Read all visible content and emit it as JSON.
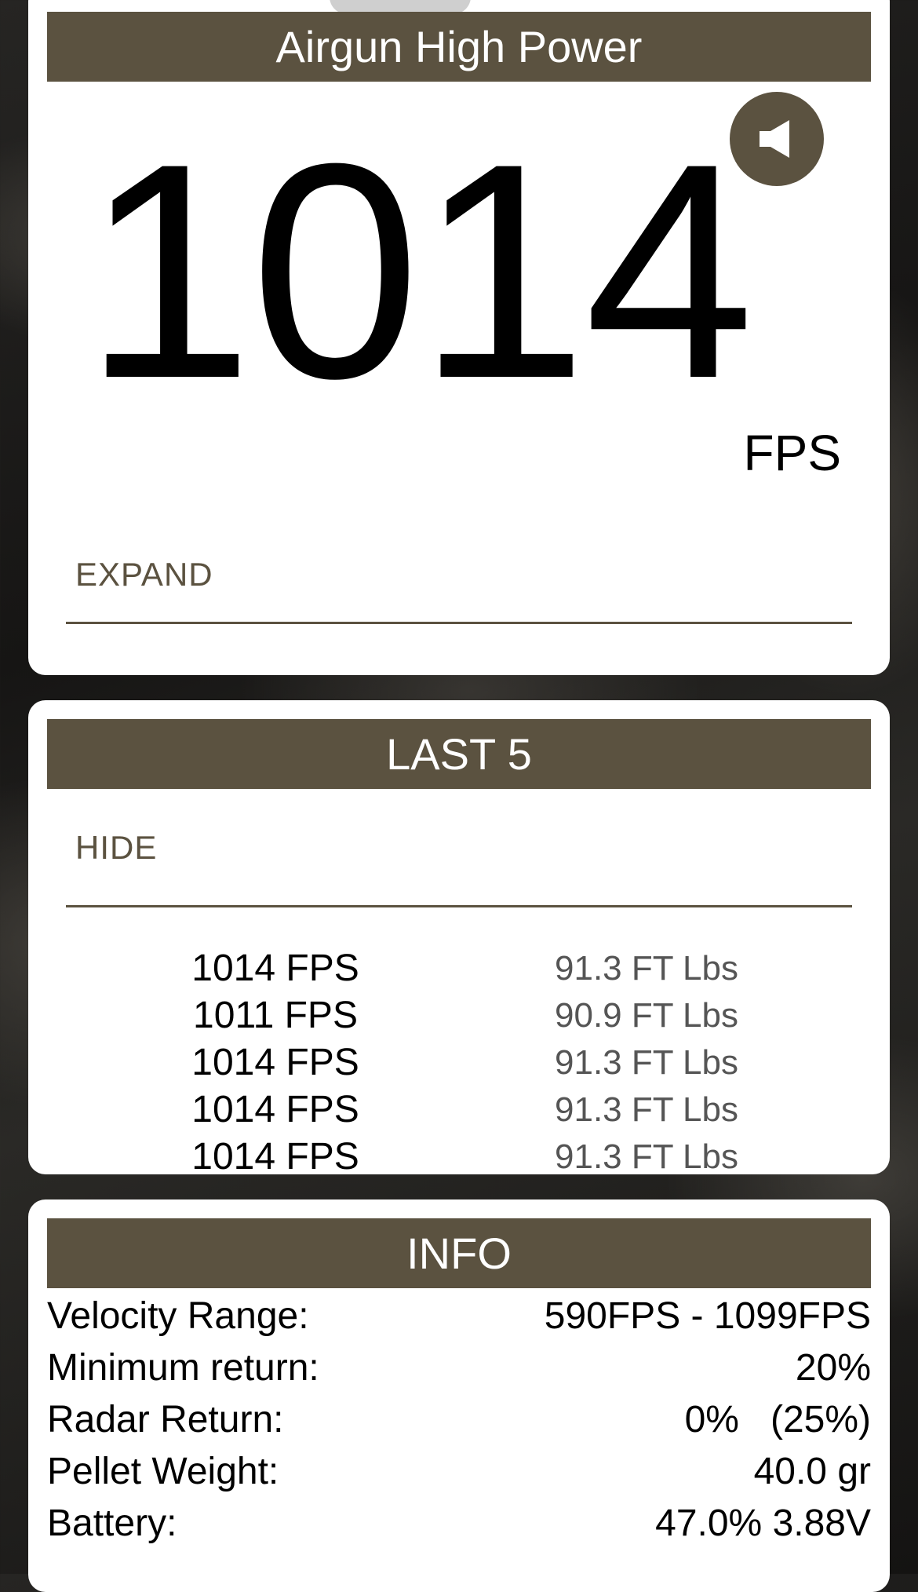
{
  "current": {
    "title": "Airgun High Power",
    "velocity": "1014",
    "unit": "FPS",
    "expand_label": "EXPAND",
    "speaker_icon": "speaker-icon"
  },
  "last5": {
    "title": "LAST 5",
    "hide_label": "HIDE",
    "shots": [
      {
        "fps": "1014 FPS",
        "energy": "91.3 FT Lbs"
      },
      {
        "fps": "1011 FPS",
        "energy": "90.9 FT Lbs"
      },
      {
        "fps": "1014 FPS",
        "energy": "91.3 FT Lbs"
      },
      {
        "fps": "1014 FPS",
        "energy": "91.3 FT Lbs"
      },
      {
        "fps": "1014 FPS",
        "energy": "91.3 FT Lbs"
      }
    ]
  },
  "info": {
    "title": "INFO",
    "rows": [
      {
        "label": "Velocity Range:",
        "value": "590FPS - 1099FPS"
      },
      {
        "label": "Minimum return:",
        "value": "20%"
      },
      {
        "label": "Radar Return:",
        "value": "0%   (25%)"
      },
      {
        "label": "Pellet Weight:",
        "value": "40.0 gr"
      },
      {
        "label": "Battery:",
        "value": "47.0% 3.88V"
      }
    ]
  },
  "colors": {
    "accent": "#5b5240",
    "card": "#ffffff",
    "secondary_text": "#555555"
  }
}
